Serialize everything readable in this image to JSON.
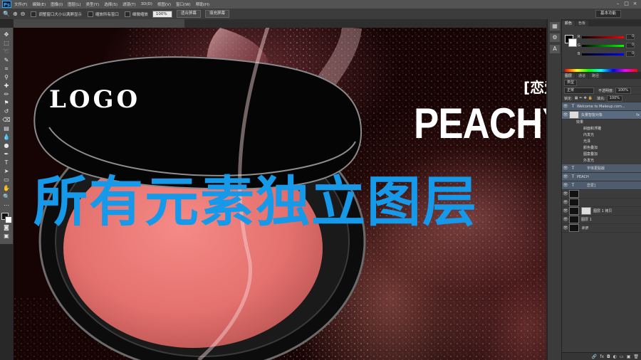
{
  "app": {
    "logo": "Ps"
  },
  "menu": [
    "文件(F)",
    "编辑(E)",
    "图像(I)",
    "图层(L)",
    "类型(Y)",
    "选择(S)",
    "滤镜(T)",
    "3D(D)",
    "视图(V)",
    "窗口(W)",
    "帮助(H)"
  ],
  "window_controls": [
    "–",
    "□",
    "×"
  ],
  "options_bar": {
    "tool_icon": "zoom-icon",
    "check1_label": "调整窗口大小以满屏显示",
    "check2_label": "缩放所有窗口",
    "check3_label": "细微缩放",
    "zoom_value": "100%",
    "fit_button": "适合屏幕",
    "fill_button": "填充屏幕",
    "workspace": "基本功能"
  },
  "canvas": {
    "logo_text": "LOGO",
    "brand_sub": "[恋爱",
    "brand_title": "PEACHY",
    "overlay_text": "所有元素独立图层"
  },
  "color_panel": {
    "tabs": [
      "颜色",
      "色板"
    ],
    "r_label": "R",
    "g_label": "G",
    "b_label": "B",
    "r_value": "0",
    "g_value": "0",
    "b_value": "0"
  },
  "layers_panel": {
    "tabs": [
      "图层",
      "通道",
      "路径"
    ],
    "kind_filter": "类型",
    "blend_mode": "正常",
    "opacity_label": "不透明度:",
    "opacity_value": "100%",
    "lock_label": "锁定:",
    "fill_label": "填充:",
    "fill_value": "100%",
    "layers": [
      {
        "name": "Welcome to Makeup.com...",
        "type": "T"
      },
      {
        "name": "矢量智能对象",
        "type": "fx"
      },
      {
        "name": "字体更贴版",
        "type": "T"
      },
      {
        "name": "PEACH",
        "type": "T"
      },
      {
        "name": "恋爱]",
        "type": "T"
      },
      {
        "name": "",
        "type": ""
      },
      {
        "name": "",
        "type": ""
      },
      {
        "name": "图层 1 拷贝",
        "type": ""
      },
      {
        "name": "图层 1",
        "type": ""
      },
      {
        "name": "背景",
        "type": ""
      }
    ],
    "effects_label": "效果",
    "effects": [
      "斜面和浮雕",
      "内发光",
      "光泽",
      "颜色叠加",
      "图案叠加",
      "外发光"
    ]
  }
}
